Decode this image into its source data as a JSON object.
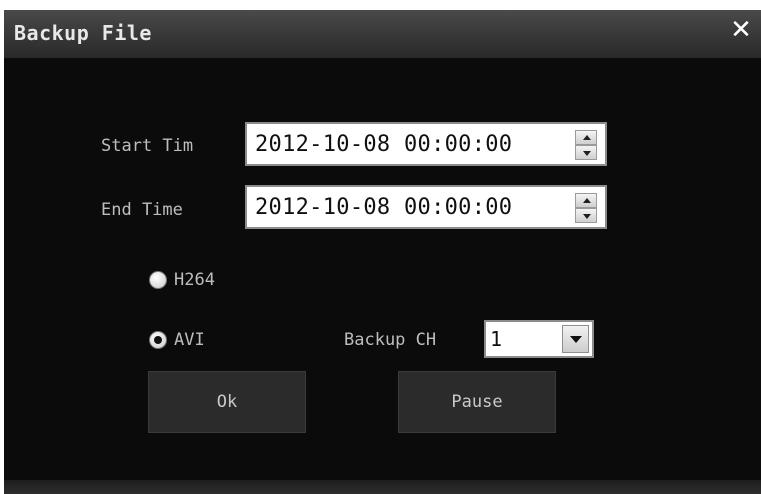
{
  "dialog": {
    "title": "Backup File",
    "close_icon": "close-icon"
  },
  "form": {
    "start_time_label": "Start Tim",
    "start_time_value": "2012-10-08 00:00:00",
    "end_time_label": "End Time",
    "end_time_value": "2012-10-08 00:00:00",
    "format_options": [
      {
        "label": "H264",
        "selected": false
      },
      {
        "label": "AVI",
        "selected": true
      }
    ],
    "backup_ch_label": "Backup CH",
    "backup_ch_value": "1"
  },
  "buttons": {
    "ok_label": "Ok",
    "pause_label": "Pause"
  },
  "colors": {
    "dialog_background": "#0b0b0b",
    "title_text": "#e8e8e8",
    "label_text": "#bdbdbd",
    "button_background": "#2b2b2b"
  }
}
